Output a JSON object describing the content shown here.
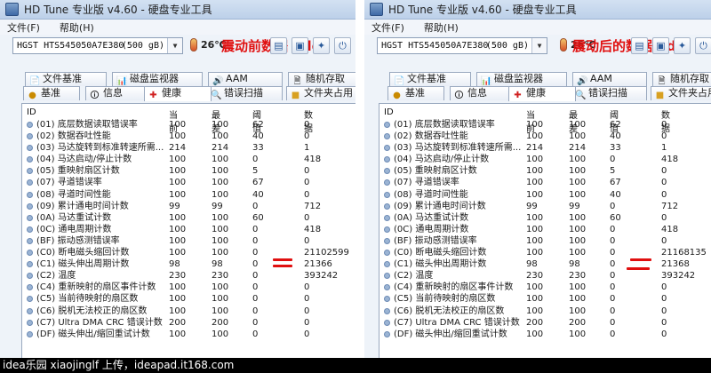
{
  "caption": "idea乐园 xiaojinglf 上传，ideapad.it168.com",
  "app_title": "HD Tune 专业版 v4.60 - 硬盘专业工具",
  "menu": [
    "文件(F)",
    "帮助(H)"
  ],
  "drive": {
    "name": "HGST HTS545050A7E380",
    "size": "(500 gB)"
  },
  "temperature": "26℃",
  "tabs_top": [
    "文件基准",
    "磁盘监视器",
    "AAM",
    "随机存取"
  ],
  "tabs_bottom": [
    "基准",
    "信息",
    "健康",
    "错误扫描",
    "文件夹占用"
  ],
  "columns": [
    "ID",
    "当前",
    "最差",
    "阈值",
    "数据"
  ],
  "colors": {
    "annotation": "#e01010",
    "window_bg": "#eef3f9",
    "caption_bg": "#000000"
  },
  "windows": [
    {
      "annotation": "震动前数据 hdd",
      "rows": [
        {
          "id": "(01) 底层数据读取错误率",
          "cur": "100",
          "worst": "100",
          "thr": "62",
          "data": "0"
        },
        {
          "id": "(02) 数据吞吐性能",
          "cur": "100",
          "worst": "100",
          "thr": "40",
          "data": "0"
        },
        {
          "id": "(03) 马达旋转到标准转速所需...",
          "cur": "214",
          "worst": "214",
          "thr": "33",
          "data": "1"
        },
        {
          "id": "(04) 马达启动/停止计数",
          "cur": "100",
          "worst": "100",
          "thr": "0",
          "data": "418"
        },
        {
          "id": "(05) 重映射扇区计数",
          "cur": "100",
          "worst": "100",
          "thr": "5",
          "data": "0"
        },
        {
          "id": "(07) 寻道错误率",
          "cur": "100",
          "worst": "100",
          "thr": "67",
          "data": "0"
        },
        {
          "id": "(08) 寻道时间性能",
          "cur": "100",
          "worst": "100",
          "thr": "40",
          "data": "0"
        },
        {
          "id": "(09) 累计通电时间计数",
          "cur": "99",
          "worst": "99",
          "thr": "0",
          "data": "712"
        },
        {
          "id": "(0A) 马达重试计数",
          "cur": "100",
          "worst": "100",
          "thr": "60",
          "data": "0"
        },
        {
          "id": "(0C) 通电周期计数",
          "cur": "100",
          "worst": "100",
          "thr": "0",
          "data": "418"
        },
        {
          "id": "(BF) 振动感测错误率",
          "cur": "100",
          "worst": "100",
          "thr": "0",
          "data": "0"
        },
        {
          "id": "(C0) 断电磁头缩回计数",
          "cur": "100",
          "worst": "100",
          "thr": "0",
          "data": "21102599"
        },
        {
          "id": "(C1) 磁头伸出周期计数",
          "cur": "98",
          "worst": "98",
          "thr": "0",
          "data": "21366"
        },
        {
          "id": "(C2) 温度",
          "cur": "230",
          "worst": "230",
          "thr": "0",
          "data": "393242"
        },
        {
          "id": "(C4) 重新映射的扇区事件计数",
          "cur": "100",
          "worst": "100",
          "thr": "0",
          "data": "0"
        },
        {
          "id": "(C5) 当前待映射的扇区数",
          "cur": "100",
          "worst": "100",
          "thr": "0",
          "data": "0"
        },
        {
          "id": "(C6) 脱机无法校正的扇区数",
          "cur": "100",
          "worst": "100",
          "thr": "0",
          "data": "0"
        },
        {
          "id": "(C7) Ultra DMA CRC 错误计数",
          "cur": "200",
          "worst": "200",
          "thr": "0",
          "data": "0"
        },
        {
          "id": "(DF) 磁头伸出/缩回重试计数",
          "cur": "100",
          "worst": "100",
          "thr": "0",
          "data": "0"
        }
      ]
    },
    {
      "annotation": "震动后的数据 hdd",
      "rows": [
        {
          "id": "(01) 底层数据读取错误率",
          "cur": "100",
          "worst": "100",
          "thr": "62",
          "data": "0"
        },
        {
          "id": "(02) 数据吞吐性能",
          "cur": "100",
          "worst": "100",
          "thr": "40",
          "data": "0"
        },
        {
          "id": "(03) 马达旋转到标准转速所需...",
          "cur": "214",
          "worst": "214",
          "thr": "33",
          "data": "1"
        },
        {
          "id": "(04) 马达启动/停止计数",
          "cur": "100",
          "worst": "100",
          "thr": "0",
          "data": "418"
        },
        {
          "id": "(05) 重映射扇区计数",
          "cur": "100",
          "worst": "100",
          "thr": "5",
          "data": "0"
        },
        {
          "id": "(07) 寻道错误率",
          "cur": "100",
          "worst": "100",
          "thr": "67",
          "data": "0"
        },
        {
          "id": "(08) 寻道时间性能",
          "cur": "100",
          "worst": "100",
          "thr": "40",
          "data": "0"
        },
        {
          "id": "(09) 累计通电时间计数",
          "cur": "99",
          "worst": "99",
          "thr": "0",
          "data": "712"
        },
        {
          "id": "(0A) 马达重试计数",
          "cur": "100",
          "worst": "100",
          "thr": "60",
          "data": "0"
        },
        {
          "id": "(0C) 通电周期计数",
          "cur": "100",
          "worst": "100",
          "thr": "0",
          "data": "418"
        },
        {
          "id": "(BF) 振动感测错误率",
          "cur": "100",
          "worst": "100",
          "thr": "0",
          "data": "0"
        },
        {
          "id": "(C0) 断电磁头缩回计数",
          "cur": "100",
          "worst": "100",
          "thr": "0",
          "data": "21168135"
        },
        {
          "id": "(C1) 磁头伸出周期计数",
          "cur": "98",
          "worst": "98",
          "thr": "0",
          "data": "21368"
        },
        {
          "id": "(C2) 温度",
          "cur": "230",
          "worst": "230",
          "thr": "0",
          "data": "393242"
        },
        {
          "id": "(C4) 重新映射的扇区事件计数",
          "cur": "100",
          "worst": "100",
          "thr": "0",
          "data": "0"
        },
        {
          "id": "(C5) 当前待映射的扇区数",
          "cur": "100",
          "worst": "100",
          "thr": "0",
          "data": "0"
        },
        {
          "id": "(C6) 脱机无法校正的扇区数",
          "cur": "100",
          "worst": "100",
          "thr": "0",
          "data": "0"
        },
        {
          "id": "(C7) Ultra DMA CRC 错误计数",
          "cur": "200",
          "worst": "200",
          "thr": "0",
          "data": "0"
        },
        {
          "id": "(DF) 磁头伸出/缩回重试计数",
          "cur": "100",
          "worst": "100",
          "thr": "0",
          "data": "0"
        }
      ]
    }
  ]
}
